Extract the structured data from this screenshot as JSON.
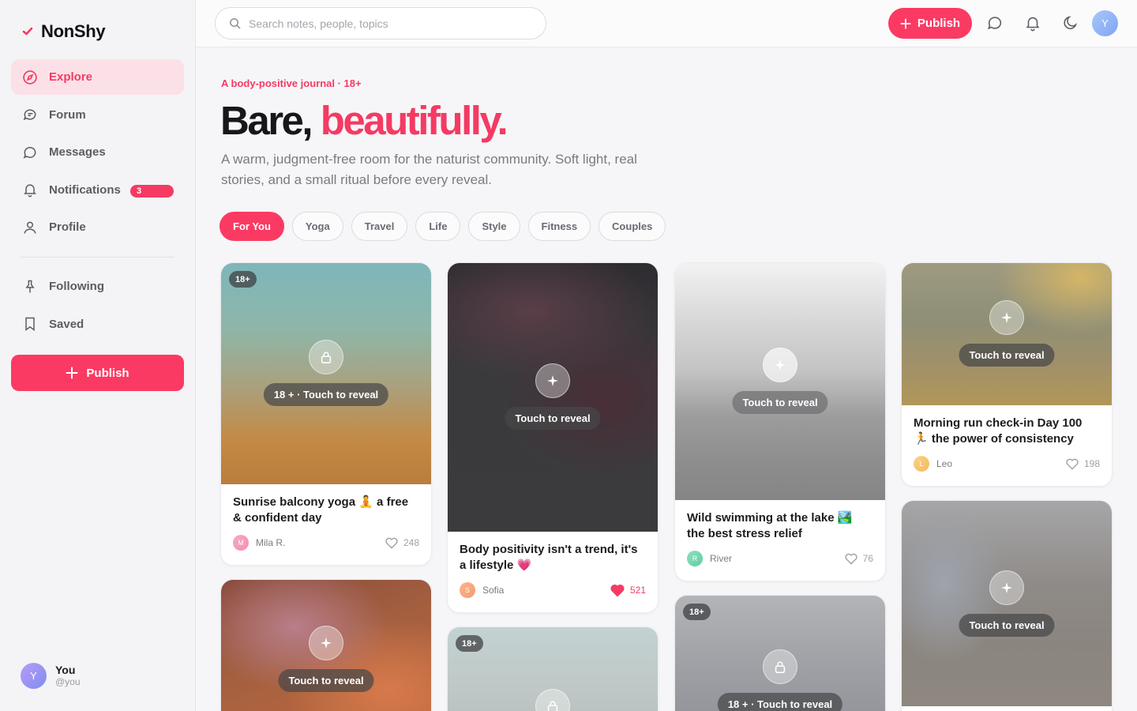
{
  "app": {
    "name": "NonShy",
    "accent": "#fb3a63"
  },
  "sidebar": {
    "items": [
      {
        "label": "Explore",
        "icon": "compass-icon",
        "active": true
      },
      {
        "label": "Forum",
        "icon": "forum-icon"
      },
      {
        "label": "Messages",
        "icon": "message-icon"
      },
      {
        "label": "Notifications",
        "icon": "bell-icon",
        "badge": "3"
      },
      {
        "label": "Profile",
        "icon": "user-icon"
      }
    ],
    "secondary": [
      {
        "label": "Following",
        "icon": "pin-icon"
      },
      {
        "label": "Saved",
        "icon": "bookmark-icon"
      }
    ],
    "publish_label": "Publish",
    "user": {
      "initial": "Y",
      "name": "You",
      "handle": "@you"
    }
  },
  "header": {
    "search_placeholder": "Search notes, people, topics",
    "publish_label": "Publish",
    "avatar_initial": "Y"
  },
  "hero": {
    "eyebrow": "A body-positive journal · 18+",
    "title_plain": "Bare,",
    "title_accent": "beautifully.",
    "description": "A warm, judgment-free room for the naturist community. Soft light, real stories, and a small ritual before every reveal."
  },
  "chips": [
    "For You",
    "Yoga",
    "Travel",
    "Life",
    "Style",
    "Fitness",
    "Couples"
  ],
  "cards": [
    {
      "badge": "18+",
      "reveal": "18 + · Touch to reveal",
      "lock": true,
      "title": "Sunrise balcony yoga 🧘 a free & confident day",
      "author": "Mila R.",
      "author_initial": "M",
      "likes": "248",
      "liked": false
    },
    {
      "reveal": "Touch to reveal",
      "title": "Body positivity isn't a trend, it's a lifestyle 💗",
      "author": "Sofia",
      "author_initial": "S",
      "likes": "521",
      "liked": true
    },
    {
      "reveal": "Touch to reveal",
      "title": "Wild swimming at the lake 🏞️ the best stress relief",
      "author": "River",
      "author_initial": "R",
      "likes": "76",
      "liked": false
    },
    {
      "reveal": "Touch to reveal",
      "title": "Morning run check-in Day 100 🏃 the power of consistency",
      "author": "Leo",
      "author_initial": "L",
      "likes": "198",
      "liked": false
    },
    {
      "reveal": "Touch to reveal"
    },
    {
      "badge": "18+",
      "lock": true
    },
    {
      "badge": "18+",
      "reveal": "18 + · Touch to reveal",
      "lock": true
    },
    {
      "reveal": "Touch to reveal"
    }
  ]
}
